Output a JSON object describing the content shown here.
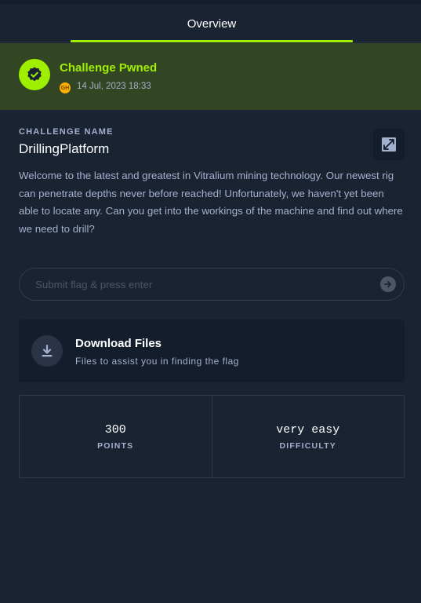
{
  "tabs": [
    {
      "label": "Overview",
      "active": true
    }
  ],
  "status": {
    "title": "Challenge Pwned",
    "date": "14 Jul, 2023 18:33",
    "avatar_initials": "GH",
    "accent_color": "#9fef00"
  },
  "challenge": {
    "section_label": "CHALLENGE NAME",
    "name": "DrillingPlatform",
    "description": "Welcome to the latest and greatest in Vitralium mining technology. Our newest rig can penetrate depths never before reached! Unfortunately, we haven't yet been able to locate any. Can you get into the workings of the machine and find out where we need to drill?"
  },
  "share": {
    "icon": "share-icon"
  },
  "flag": {
    "placeholder": "Submit flag & press enter",
    "value": ""
  },
  "download": {
    "title": "Download Files",
    "subtitle": "Files to assist you in finding the flag",
    "icon": "download-icon"
  },
  "stats": [
    {
      "value": "300",
      "label": "POINTS"
    },
    {
      "value": "very easy",
      "label": "DIFFICULTY"
    }
  ],
  "colors": {
    "background": "#1a2332",
    "pwned_banner": "#334624",
    "accent": "#9fef00",
    "panel": "#141d2b"
  }
}
